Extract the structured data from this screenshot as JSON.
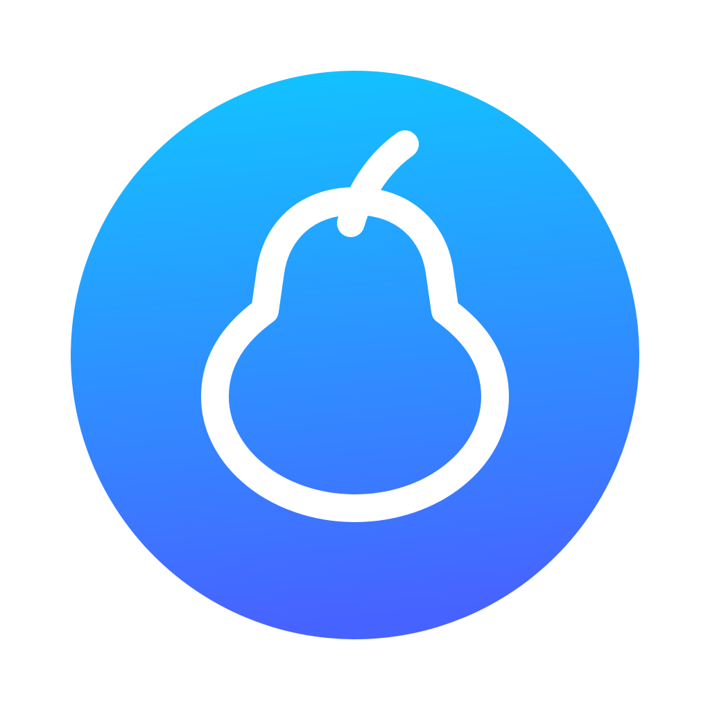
{
  "icon": {
    "name": "pear-icon",
    "background_gradient": {
      "top_color": "#10c6ff",
      "bottom_color": "#4763ff"
    },
    "outline_color": "#ffffff",
    "page_background": "#ffffff"
  }
}
